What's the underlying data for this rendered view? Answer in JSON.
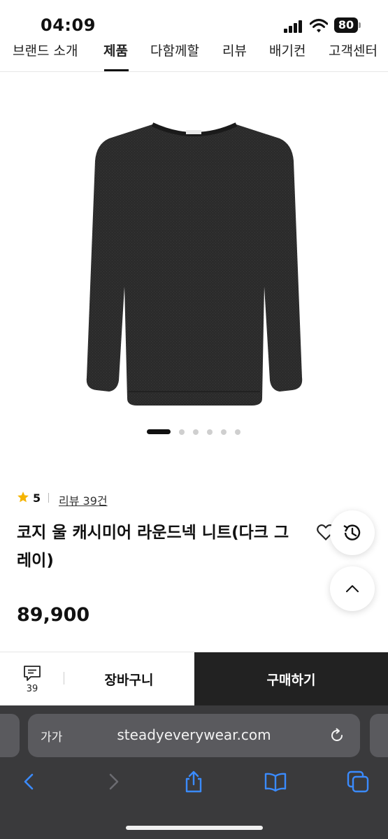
{
  "status": {
    "time": "04:09",
    "battery": "80"
  },
  "nav": {
    "items": [
      "브랜드 소개",
      "제품",
      "다함께할",
      "리뷰",
      "배기컨",
      "고객센터"
    ],
    "active_index": 1
  },
  "product": {
    "rating_score": "5",
    "review_link": "리뷰 39건",
    "title": "코지 울 캐시미어 라운드넥 니트(다크 그레이)",
    "price": "89,900",
    "image_count": 6,
    "active_image_index": 0
  },
  "buy_bar": {
    "chat_count": "39",
    "cart_label": "장바구니",
    "purchase_label": "구매하기"
  },
  "browser": {
    "text_size_label": "가가",
    "url": "steadyeverywear.com"
  },
  "colors": {
    "accent": "#222222",
    "star": "#f5b400",
    "browser_bg": "#3a3a3c",
    "toolbar_icon": "#3a8bff"
  }
}
